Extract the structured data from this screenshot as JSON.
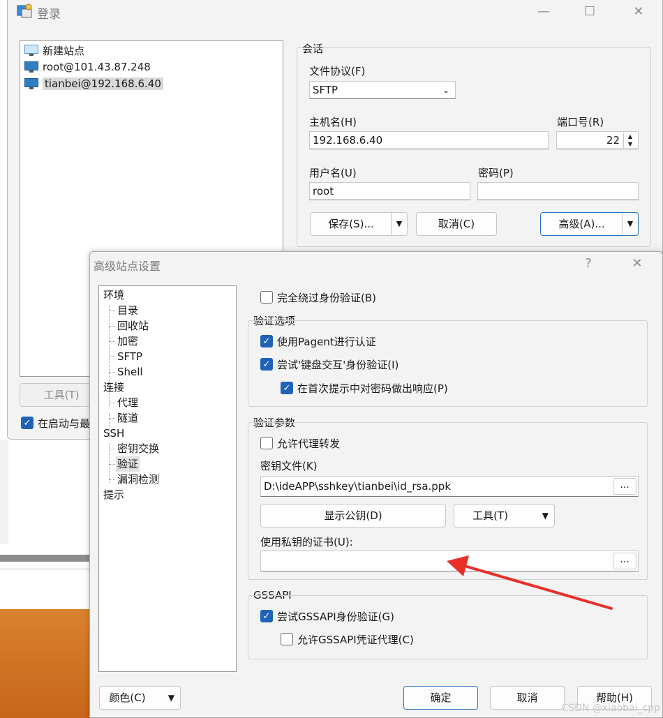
{
  "login": {
    "title": "登录",
    "sites": [
      "新建站点",
      "root@101.43.87.248",
      "tianbei@192.168.6.40"
    ],
    "selected_site_index": 2,
    "tools_button": "工具(T)",
    "startup_checkbox_label": "在启动与最",
    "session": {
      "group_label": "会话",
      "protocol_label": "文件协议(F)",
      "protocol_value": "SFTP",
      "host_label": "主机名(H)",
      "host_value": "192.168.6.40",
      "port_label": "端口号(R)",
      "port_value": "22",
      "user_label": "用户名(U)",
      "user_value": "root",
      "password_label": "密码(P)",
      "password_value": "",
      "save_button": "保存(S)...",
      "cancel_button": "取消(C)",
      "advanced_button": "高级(A)..."
    }
  },
  "advanced": {
    "title": "高级站点设置",
    "help_glyph": "?",
    "nav": [
      {
        "label": "环境",
        "level": 0
      },
      {
        "label": "目录",
        "level": 1
      },
      {
        "label": "回收站",
        "level": 1
      },
      {
        "label": "加密",
        "level": 1
      },
      {
        "label": "SFTP",
        "level": 1
      },
      {
        "label": "Shell",
        "level": 1
      },
      {
        "label": "连接",
        "level": 0
      },
      {
        "label": "代理",
        "level": 1
      },
      {
        "label": "隧道",
        "level": 1
      },
      {
        "label": "SSH",
        "level": 0
      },
      {
        "label": "密钥交换",
        "level": 1
      },
      {
        "label": "验证",
        "level": 1,
        "selected": true
      },
      {
        "label": "漏洞检测",
        "level": 1
      },
      {
        "label": "提示",
        "level": 0
      }
    ],
    "bypass_auth": {
      "label": "完全绕过身份验证(B)",
      "checked": false
    },
    "auth_options": {
      "group_label": "验证选项",
      "pagent": {
        "label": "使用Pagent进行认证",
        "checked": true
      },
      "keyboard": {
        "label": "尝试'键盘交互'身份验证(I)",
        "checked": true
      },
      "respond": {
        "label": "在首次提示中对密码做出响应(P)",
        "checked": true
      }
    },
    "auth_params": {
      "group_label": "验证参数",
      "agent_forward": {
        "label": "允许代理转发",
        "checked": false
      },
      "key_file_label": "密钥文件(K)",
      "key_file_value": "D:\\ideAPP\\sshkey\\tianbei\\id_rsa.ppk",
      "browse": "...",
      "show_pubkey_button": "显示公钥(D)",
      "tools_button": "工具(T)",
      "cert_label": "使用私钥的证书(U):",
      "cert_value": ""
    },
    "gssapi": {
      "group_label": "GSSAPI",
      "try": {
        "label": "尝试GSSAPI身份验证(G)",
        "checked": true
      },
      "delegate": {
        "label": "允许GSSAPI凭证代理(C)",
        "checked": false
      }
    },
    "color_button": "颜色(C)",
    "ok_button": "确定",
    "cancel_button": "取消",
    "help_button": "帮助(H)"
  },
  "watermark": "CSDN @xiaobai_cpp",
  "colors": {
    "accent": "#1e63b8",
    "arrow": "#e8302a"
  }
}
